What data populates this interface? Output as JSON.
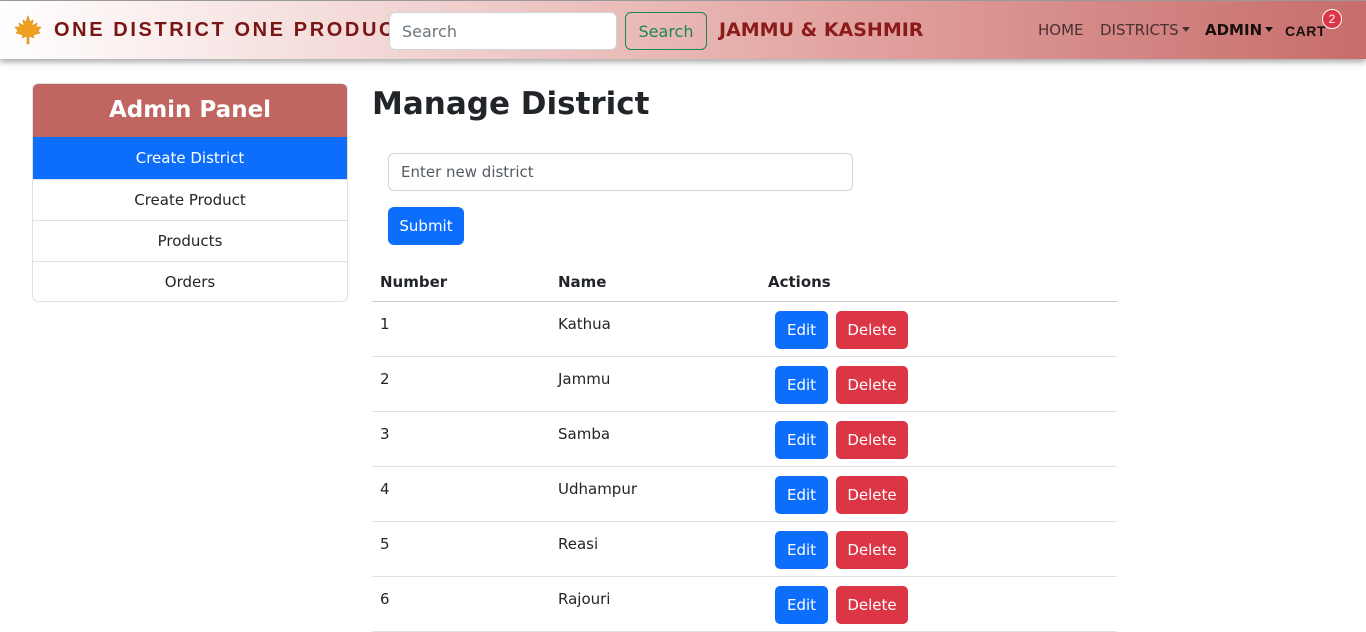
{
  "navbar": {
    "brand_icon": "maple-leaf-icon",
    "brand": "ONE DISTRICT ONE PRODUCT",
    "search_placeholder": "Search",
    "search_button": "Search",
    "state": "JAMMU & KASHMIR",
    "links": {
      "home": "HOME",
      "districts": "DISTRICTS",
      "admin": "ADMIN",
      "cart": "CART"
    },
    "cart_count": "2",
    "colors": {
      "brand_text": "#7a1515",
      "badge": "#dc3545",
      "search_button": "#198754"
    }
  },
  "sidebar": {
    "title": "Admin Panel",
    "items": [
      {
        "label": "Create District",
        "active": true
      },
      {
        "label": "Create Product",
        "active": false
      },
      {
        "label": "Products",
        "active": false
      },
      {
        "label": "Orders",
        "active": false
      }
    ],
    "colors": {
      "header": "#c06560",
      "active": "#0d6efd"
    }
  },
  "main": {
    "title": "Manage District",
    "input_placeholder": "Enter new district",
    "submit_label": "Submit",
    "table": {
      "headers": {
        "number": "Number",
        "name": "Name",
        "actions": "Actions"
      },
      "edit_label": "Edit",
      "delete_label": "Delete",
      "rows": [
        {
          "number": "1",
          "name": "Kathua"
        },
        {
          "number": "2",
          "name": "Jammu"
        },
        {
          "number": "3",
          "name": "Samba"
        },
        {
          "number": "4",
          "name": "Udhampur"
        },
        {
          "number": "5",
          "name": "Reasi"
        },
        {
          "number": "6",
          "name": "Rajouri"
        }
      ]
    }
  }
}
